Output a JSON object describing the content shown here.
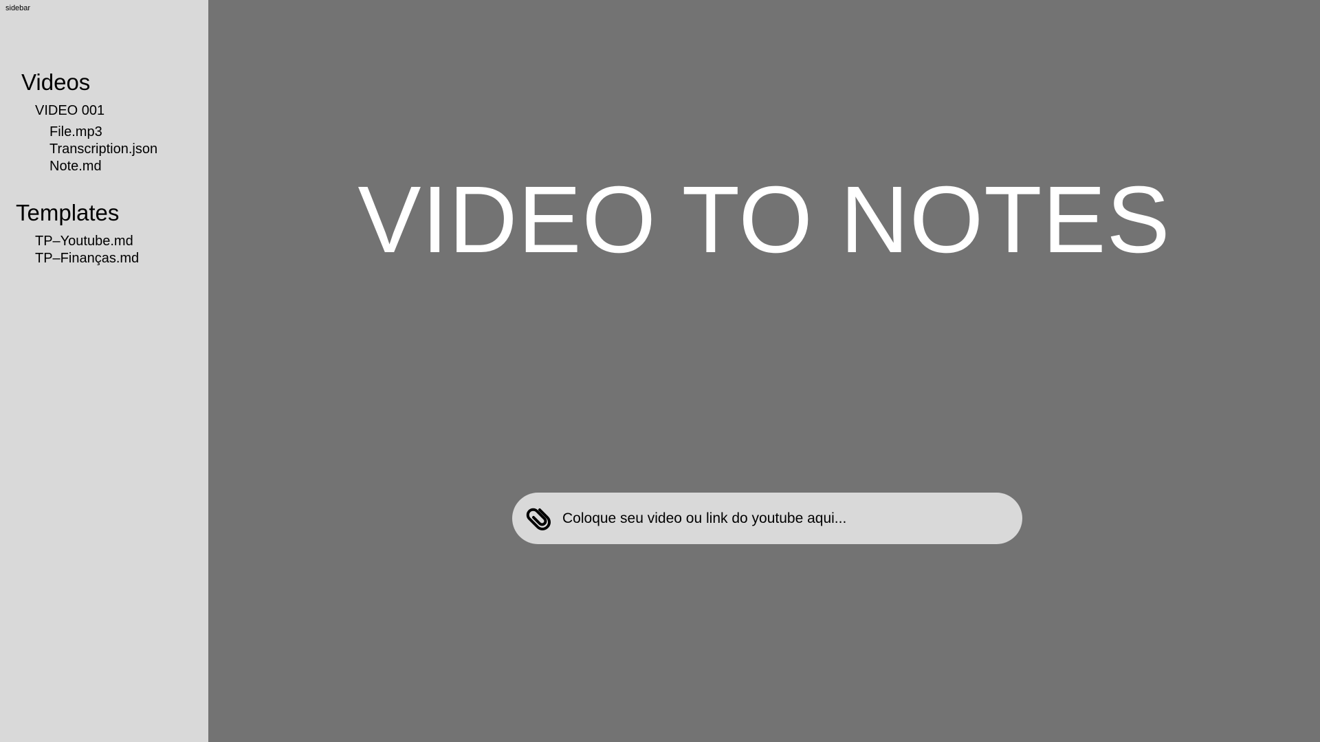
{
  "sidebar": {
    "caption": "sidebar",
    "videos_title": "Videos",
    "video_folder": "VIDEO 001",
    "video_files": [
      "File.mp3",
      "Transcription.json",
      "Note.md"
    ],
    "templates_title": "Templates",
    "templates": [
      "TP–Youtube.md",
      "TP–Finanças.md"
    ]
  },
  "main": {
    "title": "VIDEO TO NOTES",
    "input": {
      "placeholder": "Coloque seu video ou link do youtube aqui...",
      "icon": "paperclip-icon"
    }
  },
  "colors": {
    "sidebar_bg": "#d9d9d9",
    "main_bg": "#737373",
    "title_text": "#ffffff",
    "input_bg": "#d9d9d9"
  }
}
